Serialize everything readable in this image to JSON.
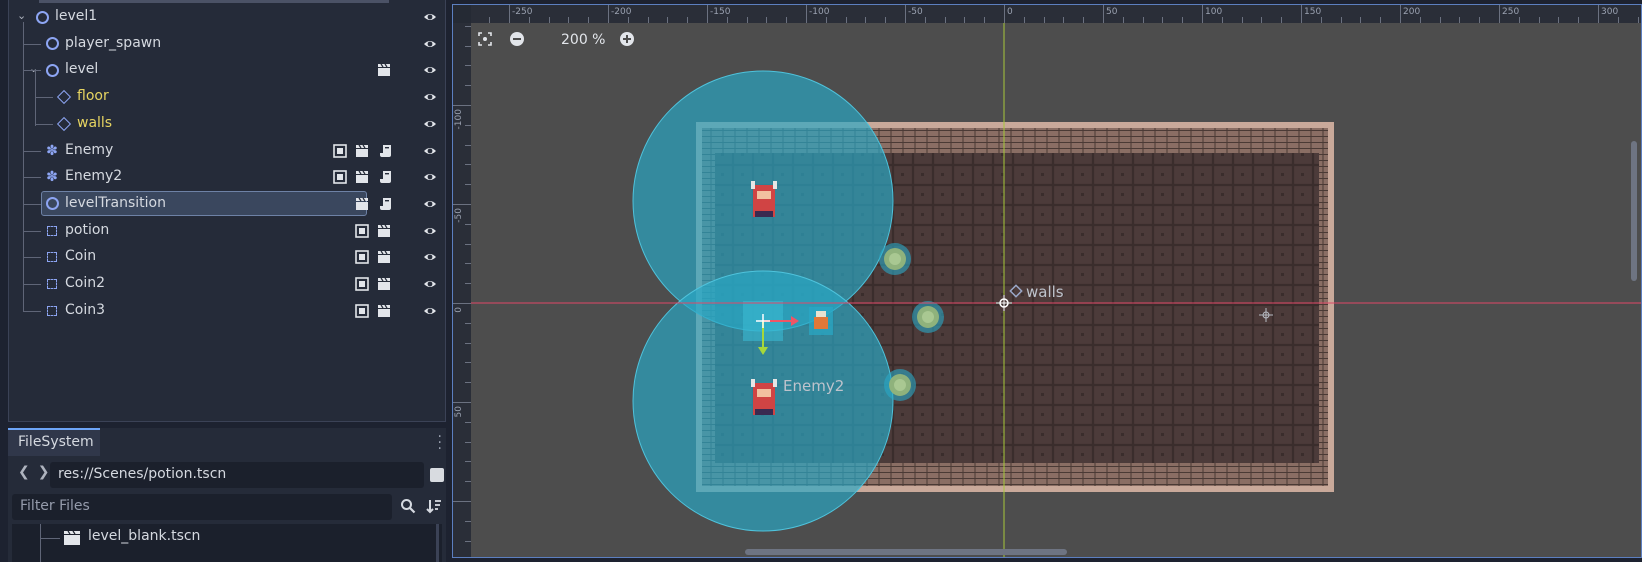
{
  "scene_tree": {
    "nodes": [
      {
        "label": "level1",
        "icon": "node-icon",
        "indent": 0,
        "expandable": true
      },
      {
        "label": "player_spawn",
        "icon": "node-icon",
        "indent": 1
      },
      {
        "label": "level",
        "icon": "node-icon",
        "indent": 1,
        "expandable": true,
        "badges": [
          "instance-icon"
        ]
      },
      {
        "label": "floor",
        "icon": "tilemap-icon",
        "indent": 2,
        "highlight": "#e6d461"
      },
      {
        "label": "walls",
        "icon": "tilemap-icon",
        "indent": 2,
        "highlight": "#e6d461"
      },
      {
        "label": "Enemy",
        "icon": "character-icon",
        "indent": 1,
        "badges": [
          "group-icon",
          "instance-icon",
          "script-icon"
        ]
      },
      {
        "label": "Enemy2",
        "icon": "character-icon",
        "indent": 1,
        "badges": [
          "group-icon",
          "instance-icon",
          "script-icon"
        ]
      },
      {
        "label": "levelTransition",
        "icon": "node-icon",
        "indent": 1,
        "selected": true,
        "badges": [
          "instance-icon",
          "script-icon"
        ]
      },
      {
        "label": "potion",
        "icon": "area-icon",
        "indent": 1,
        "badges": [
          "group-icon",
          "instance-icon"
        ]
      },
      {
        "label": "Coin",
        "icon": "area-icon",
        "indent": 1,
        "badges": [
          "group-icon",
          "instance-icon"
        ]
      },
      {
        "label": "Coin2",
        "icon": "area-icon",
        "indent": 1,
        "badges": [
          "group-icon",
          "instance-icon"
        ]
      },
      {
        "label": "Coin3",
        "icon": "area-icon",
        "indent": 1,
        "badges": [
          "group-icon",
          "instance-icon"
        ]
      }
    ]
  },
  "filesystem": {
    "tab_label": "FileSystem",
    "path": "res://Scenes/potion.tscn",
    "filter_placeholder": "Filter Files",
    "files": [
      {
        "label": "level_blank.tscn",
        "icon": "scene-file-icon"
      }
    ]
  },
  "viewport": {
    "zoom": "200 %",
    "ruler_x": [
      "-250",
      "-200",
      "-150",
      "-100",
      "-50",
      "0",
      "50",
      "100",
      "150",
      "200",
      "250",
      "300"
    ],
    "ruler_y": [
      "-100",
      "-50",
      "0",
      "50"
    ],
    "labels": {
      "walls": "walls",
      "enemy2": "Enemy2"
    }
  },
  "colors": {
    "accent": "#6ea5f7",
    "node_icon": "#8da5f3",
    "tilemap_text": "#e6d461",
    "selection": "#3a475e"
  }
}
